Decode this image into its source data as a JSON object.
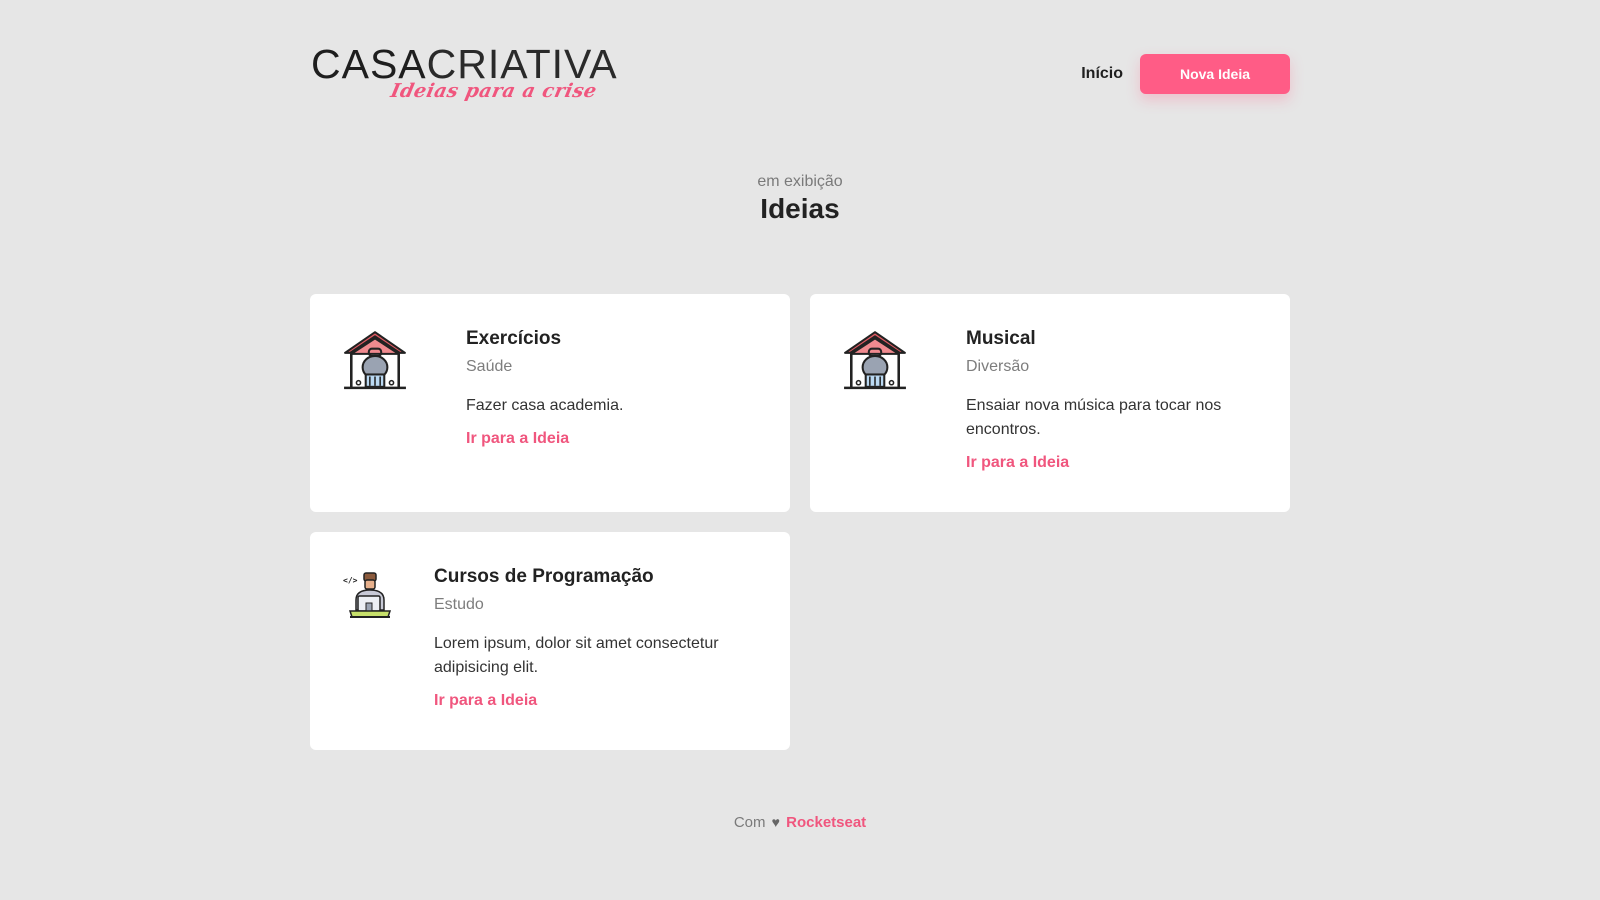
{
  "header": {
    "logo_main_part1": "CASA",
    "logo_main_part2": "CRIATIVA",
    "logo_tagline": "Ideias para a crise",
    "nav_home": "Início",
    "nav_new_idea": "Nova Ideia"
  },
  "section": {
    "subtitle": "em exibição",
    "title": "Ideias"
  },
  "ideas": [
    {
      "title": "Exercícios",
      "category": "Saúde",
      "description": "Fazer casa academia.",
      "link": "Ir para a Ideia",
      "icon": "home-gym-icon"
    },
    {
      "title": "Musical",
      "category": "Diversão",
      "description": "Ensaiar nova música para tocar nos encontros.",
      "link": "Ir para a Ideia",
      "icon": "home-gym-icon"
    },
    {
      "title": "Cursos de Programação",
      "category": "Estudo",
      "description": "Lorem ipsum, dolor sit amet consectetur adipisicing elit.",
      "link": "Ir para a Ideia",
      "icon": "programmer-icon"
    }
  ],
  "footer": {
    "prefix": "Com",
    "heart": "♥",
    "brand": "Rocketseat"
  },
  "colors": {
    "background": "#e6e6e6",
    "accent": "#ff5c86",
    "card": "#ffffff",
    "text": "#222222"
  }
}
